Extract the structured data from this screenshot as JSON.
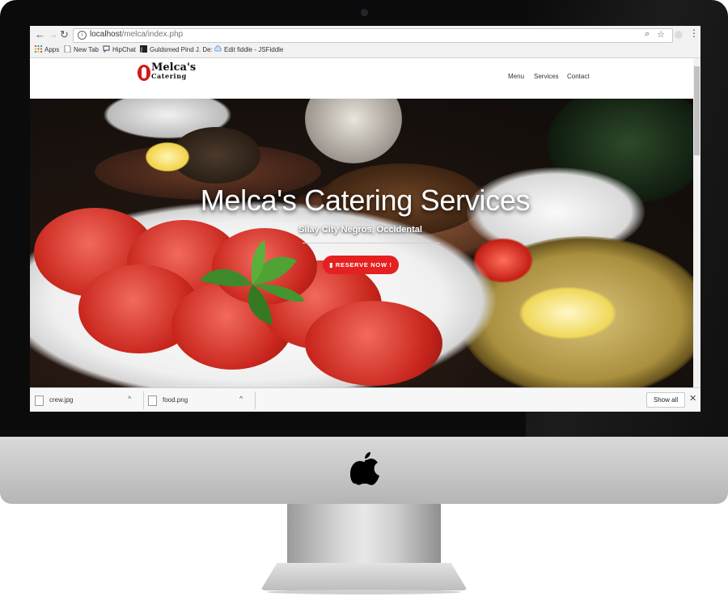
{
  "browser": {
    "url_host": "localhost",
    "url_path": "/melca/index.php",
    "bookmarks": [
      "Apps",
      "New Tab",
      "HipChat",
      "Guldsmed Pind J. De:",
      "Edit fiddle - JSFiddle"
    ]
  },
  "site": {
    "logo_line1": "Melca's",
    "logo_line2": "Catering",
    "nav": [
      "Menu",
      "Services",
      "Contact"
    ]
  },
  "hero": {
    "title": "Melca's Catering Services",
    "subtitle": "Silay City Negros, Occidental",
    "button_label": "RESERVE NOW !"
  },
  "downloads": {
    "items": [
      "crew.jpg",
      "food.png"
    ],
    "show_all_label": "Show all"
  }
}
